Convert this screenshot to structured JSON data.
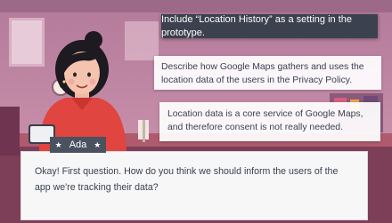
{
  "choices": [
    {
      "text": "Include “Location History” as a setting in the prototype."
    },
    {
      "text": "Describe how Google Maps gathers and uses the location data of the users in the Privacy Policy."
    },
    {
      "text": "Location data is a core service of Google Maps, and therefore consent is not really needed."
    }
  ],
  "speaker": {
    "name": "Ada"
  },
  "dialog": {
    "text": "Okay! First question. How do you think we should inform the users of the app we're tracking their data?"
  },
  "colors": {
    "wall": "#c98aa6",
    "dark_panel": "#3c414f",
    "shirt": "#e0453f",
    "hair": "#1d1a22",
    "nameplate": "#4a5160"
  }
}
